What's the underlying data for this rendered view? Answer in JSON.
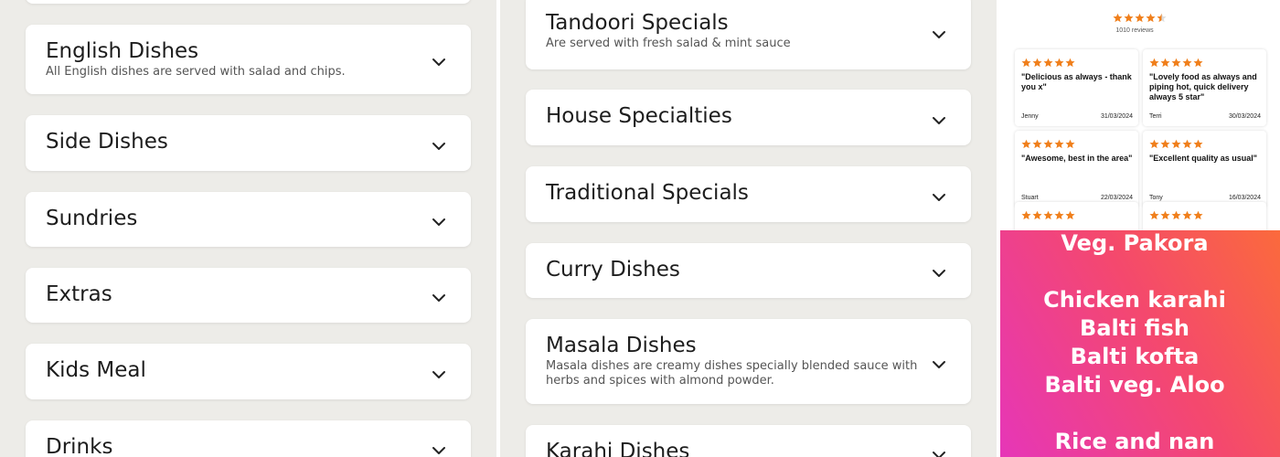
{
  "left_menu": [
    {
      "title": "English Dishes",
      "desc": "All English dishes are served with salad and chips."
    },
    {
      "title": "Side Dishes",
      "desc": ""
    },
    {
      "title": "Sundries",
      "desc": ""
    },
    {
      "title": "Extras",
      "desc": ""
    },
    {
      "title": "Kids Meal",
      "desc": ""
    },
    {
      "title": "Drinks",
      "desc": ""
    }
  ],
  "mid_menu": [
    {
      "title": "Tandoori Specials",
      "desc": "Are served with fresh salad & mint sauce"
    },
    {
      "title": "House Specialties",
      "desc": ""
    },
    {
      "title": "Traditional Specials",
      "desc": ""
    },
    {
      "title": "Curry Dishes",
      "desc": ""
    },
    {
      "title": "Masala Dishes",
      "desc": "Masala dishes are creamy dishes specially blended sauce with herbs and spices with almond powder."
    },
    {
      "title": "Karahi Dishes",
      "desc": ""
    }
  ],
  "reviews": {
    "rating": 4.5,
    "count_label": "1010 reviews",
    "star_color": "#f07f1b",
    "items": [
      {
        "quote": "\"Delicious as always - thank you x\"",
        "name": "Jenny",
        "date": "31/03/2024"
      },
      {
        "quote": "\"Lovely food as always and piping hot, quick delivery always 5 star\"",
        "name": "Terri",
        "date": "30/03/2024"
      },
      {
        "quote": "\"Awesome, best in the area\"",
        "name": "Stuart",
        "date": "22/03/2024"
      },
      {
        "quote": "\"Excellent quality as usual\"",
        "name": "Tony",
        "date": "16/03/2024"
      }
    ]
  },
  "promo": {
    "lines": [
      "Veg. Pakora",
      "",
      "Chicken karahi",
      "Balti fish",
      "Balti kofta",
      "Balti veg. Aloo",
      "",
      "Rice and nan"
    ]
  },
  "icons": {
    "chevron": "chevron-down-icon",
    "star": "star-icon"
  }
}
